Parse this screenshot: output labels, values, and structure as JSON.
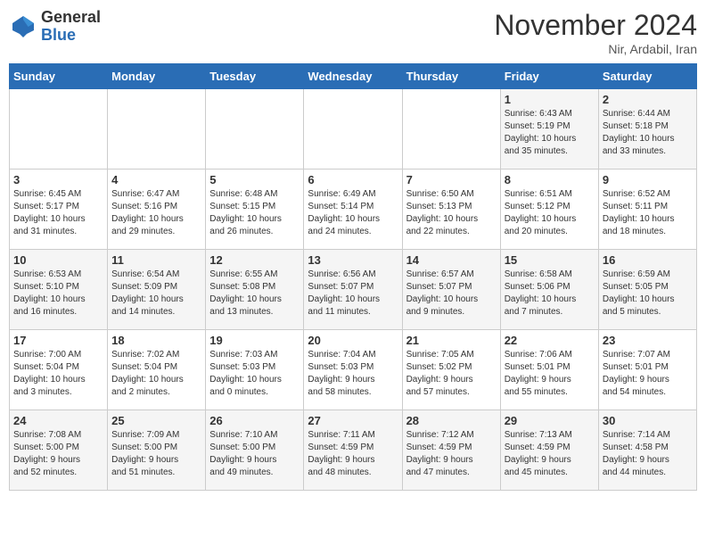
{
  "logo": {
    "general": "General",
    "blue": "Blue"
  },
  "header": {
    "month_title": "November 2024",
    "subtitle": "Nir, Ardabil, Iran"
  },
  "days_of_week": [
    "Sunday",
    "Monday",
    "Tuesday",
    "Wednesday",
    "Thursday",
    "Friday",
    "Saturday"
  ],
  "weeks": [
    [
      {
        "day": "",
        "info": ""
      },
      {
        "day": "",
        "info": ""
      },
      {
        "day": "",
        "info": ""
      },
      {
        "day": "",
        "info": ""
      },
      {
        "day": "",
        "info": ""
      },
      {
        "day": "1",
        "info": "Sunrise: 6:43 AM\nSunset: 5:19 PM\nDaylight: 10 hours\nand 35 minutes."
      },
      {
        "day": "2",
        "info": "Sunrise: 6:44 AM\nSunset: 5:18 PM\nDaylight: 10 hours\nand 33 minutes."
      }
    ],
    [
      {
        "day": "3",
        "info": "Sunrise: 6:45 AM\nSunset: 5:17 PM\nDaylight: 10 hours\nand 31 minutes."
      },
      {
        "day": "4",
        "info": "Sunrise: 6:47 AM\nSunset: 5:16 PM\nDaylight: 10 hours\nand 29 minutes."
      },
      {
        "day": "5",
        "info": "Sunrise: 6:48 AM\nSunset: 5:15 PM\nDaylight: 10 hours\nand 26 minutes."
      },
      {
        "day": "6",
        "info": "Sunrise: 6:49 AM\nSunset: 5:14 PM\nDaylight: 10 hours\nand 24 minutes."
      },
      {
        "day": "7",
        "info": "Sunrise: 6:50 AM\nSunset: 5:13 PM\nDaylight: 10 hours\nand 22 minutes."
      },
      {
        "day": "8",
        "info": "Sunrise: 6:51 AM\nSunset: 5:12 PM\nDaylight: 10 hours\nand 20 minutes."
      },
      {
        "day": "9",
        "info": "Sunrise: 6:52 AM\nSunset: 5:11 PM\nDaylight: 10 hours\nand 18 minutes."
      }
    ],
    [
      {
        "day": "10",
        "info": "Sunrise: 6:53 AM\nSunset: 5:10 PM\nDaylight: 10 hours\nand 16 minutes."
      },
      {
        "day": "11",
        "info": "Sunrise: 6:54 AM\nSunset: 5:09 PM\nDaylight: 10 hours\nand 14 minutes."
      },
      {
        "day": "12",
        "info": "Sunrise: 6:55 AM\nSunset: 5:08 PM\nDaylight: 10 hours\nand 13 minutes."
      },
      {
        "day": "13",
        "info": "Sunrise: 6:56 AM\nSunset: 5:07 PM\nDaylight: 10 hours\nand 11 minutes."
      },
      {
        "day": "14",
        "info": "Sunrise: 6:57 AM\nSunset: 5:07 PM\nDaylight: 10 hours\nand 9 minutes."
      },
      {
        "day": "15",
        "info": "Sunrise: 6:58 AM\nSunset: 5:06 PM\nDaylight: 10 hours\nand 7 minutes."
      },
      {
        "day": "16",
        "info": "Sunrise: 6:59 AM\nSunset: 5:05 PM\nDaylight: 10 hours\nand 5 minutes."
      }
    ],
    [
      {
        "day": "17",
        "info": "Sunrise: 7:00 AM\nSunset: 5:04 PM\nDaylight: 10 hours\nand 3 minutes."
      },
      {
        "day": "18",
        "info": "Sunrise: 7:02 AM\nSunset: 5:04 PM\nDaylight: 10 hours\nand 2 minutes."
      },
      {
        "day": "19",
        "info": "Sunrise: 7:03 AM\nSunset: 5:03 PM\nDaylight: 10 hours\nand 0 minutes."
      },
      {
        "day": "20",
        "info": "Sunrise: 7:04 AM\nSunset: 5:03 PM\nDaylight: 9 hours\nand 58 minutes."
      },
      {
        "day": "21",
        "info": "Sunrise: 7:05 AM\nSunset: 5:02 PM\nDaylight: 9 hours\nand 57 minutes."
      },
      {
        "day": "22",
        "info": "Sunrise: 7:06 AM\nSunset: 5:01 PM\nDaylight: 9 hours\nand 55 minutes."
      },
      {
        "day": "23",
        "info": "Sunrise: 7:07 AM\nSunset: 5:01 PM\nDaylight: 9 hours\nand 54 minutes."
      }
    ],
    [
      {
        "day": "24",
        "info": "Sunrise: 7:08 AM\nSunset: 5:00 PM\nDaylight: 9 hours\nand 52 minutes."
      },
      {
        "day": "25",
        "info": "Sunrise: 7:09 AM\nSunset: 5:00 PM\nDaylight: 9 hours\nand 51 minutes."
      },
      {
        "day": "26",
        "info": "Sunrise: 7:10 AM\nSunset: 5:00 PM\nDaylight: 9 hours\nand 49 minutes."
      },
      {
        "day": "27",
        "info": "Sunrise: 7:11 AM\nSunset: 4:59 PM\nDaylight: 9 hours\nand 48 minutes."
      },
      {
        "day": "28",
        "info": "Sunrise: 7:12 AM\nSunset: 4:59 PM\nDaylight: 9 hours\nand 47 minutes."
      },
      {
        "day": "29",
        "info": "Sunrise: 7:13 AM\nSunset: 4:59 PM\nDaylight: 9 hours\nand 45 minutes."
      },
      {
        "day": "30",
        "info": "Sunrise: 7:14 AM\nSunset: 4:58 PM\nDaylight: 9 hours\nand 44 minutes."
      }
    ]
  ]
}
